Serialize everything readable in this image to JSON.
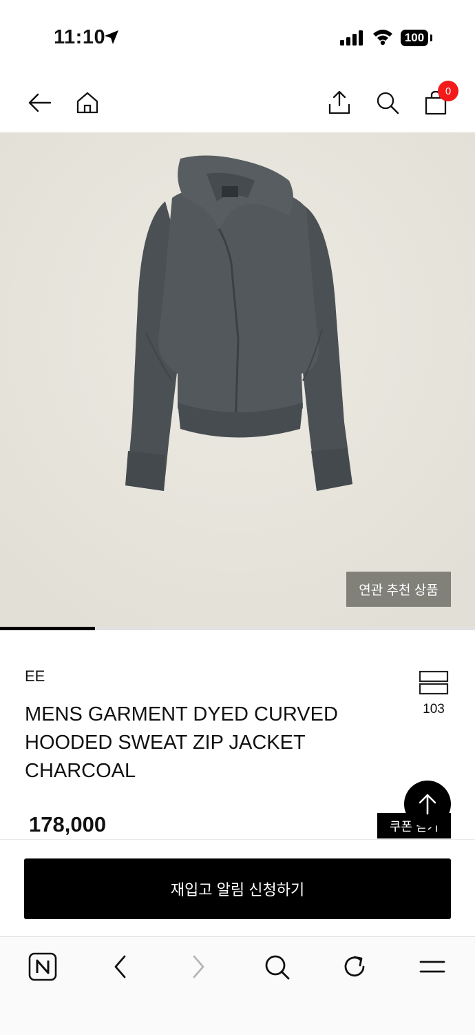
{
  "status_bar": {
    "time": "11:10",
    "battery": "100"
  },
  "header": {
    "cart_count": "0"
  },
  "gallery": {
    "related_label": "연관 추천 상품",
    "progress": 0.2
  },
  "product": {
    "brand": "EE",
    "title": "MENS GARMENT DYED CURVED HOODED SWEAT ZIP JACKET CHARCOAL",
    "compare_count": "103",
    "price": "178,000",
    "coupon_label": "쿠폰 받기"
  },
  "action": {
    "restock_label": "재입고 알림 신청하기"
  },
  "colors": {
    "accent": "#000000",
    "badge": "#f21a1a",
    "image_bg": "#e7e5dc",
    "garment": "#4f5558"
  }
}
